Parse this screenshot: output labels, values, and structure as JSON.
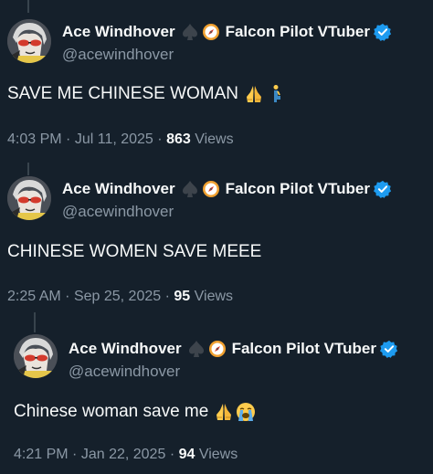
{
  "colors": {
    "background": "#15202b",
    "text_primary": "#f7f9f9",
    "text_secondary": "#8b98a5",
    "verified_blue": "#1d9bf0",
    "thread_line": "#38444d"
  },
  "tweets": [
    {
      "display_name": "Ace Windhover",
      "affiliation": "Falcon Pilot VTuber",
      "handle": "@acewindhover",
      "text": "SAVE ME CHINESE WOMAN",
      "emojis": [
        "folded-hands-emoji",
        "kneeling-person-emoji"
      ],
      "time": "4:03 PM",
      "date": "Jul 11, 2025",
      "views_count": "863",
      "views_label": "Views"
    },
    {
      "display_name": "Ace Windhover",
      "affiliation": "Falcon Pilot VTuber",
      "handle": "@acewindhover",
      "text": "CHINESE WOMEN SAVE MEEE",
      "emojis": [],
      "time": "2:25 AM",
      "date": "Sep 25, 2025",
      "views_count": "95",
      "views_label": "Views"
    },
    {
      "display_name": "Ace Windhover",
      "affiliation": "Falcon Pilot VTuber",
      "handle": "@acewindhover",
      "text": "Chinese woman save me",
      "emojis": [
        "folded-hands-emoji",
        "loudly-crying-face-emoji"
      ],
      "time": "4:21 PM",
      "date": "Jan 22, 2025",
      "views_count": "94",
      "views_label": "Views"
    }
  ]
}
